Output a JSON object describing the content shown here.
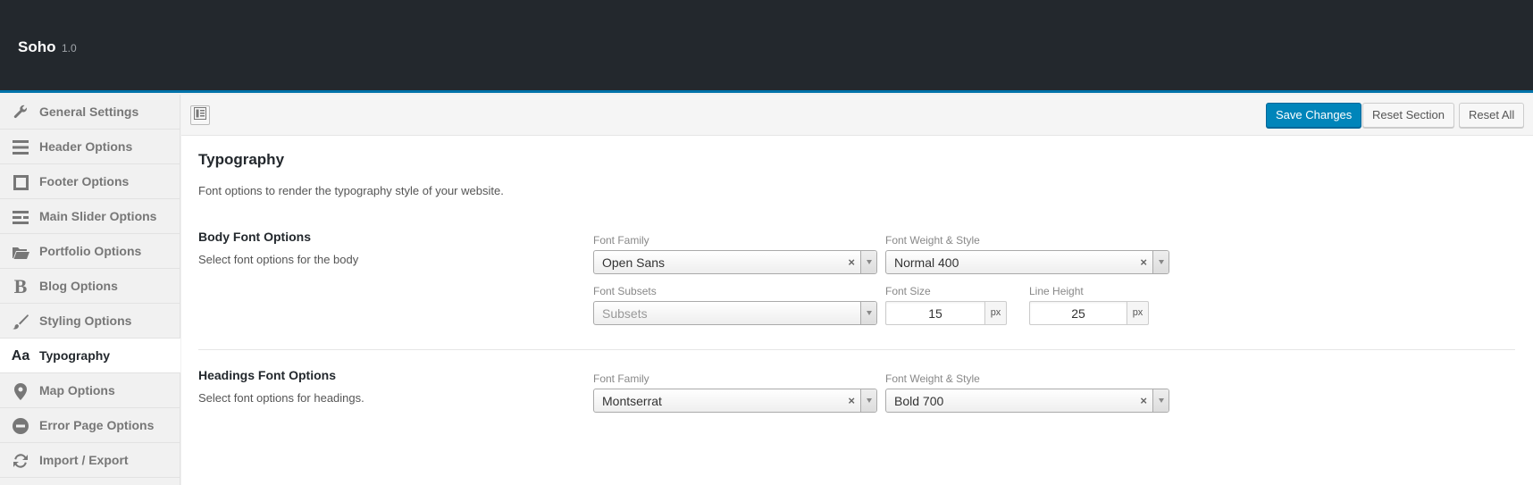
{
  "header": {
    "brand": "Soho",
    "version": "1.0"
  },
  "sidebar": {
    "items": [
      {
        "label": "General Settings",
        "icon": "wrench-icon"
      },
      {
        "label": "Header Options",
        "icon": "bars-icon"
      },
      {
        "label": "Footer Options",
        "icon": "square-icon"
      },
      {
        "label": "Main Slider Options",
        "icon": "slider-icon"
      },
      {
        "label": "Portfolio Options",
        "icon": "folder-open-icon"
      },
      {
        "label": "Blog Options",
        "icon": "bold-b-icon"
      },
      {
        "label": "Styling Options",
        "icon": "brush-icon"
      },
      {
        "label": "Typography",
        "icon": "font-aa-icon",
        "active": true
      },
      {
        "label": "Map Options",
        "icon": "map-marker-icon"
      },
      {
        "label": "Error Page Options",
        "icon": "minus-circle-icon"
      },
      {
        "label": "Import / Export",
        "icon": "refresh-icon"
      }
    ]
  },
  "toolbar": {
    "save_label": "Save Changes",
    "reset_section_label": "Reset Section",
    "reset_all_label": "Reset All"
  },
  "section": {
    "title": "Typography",
    "description": "Font options to render the typography style of your website."
  },
  "body_font": {
    "title": "Body Font Options",
    "description": "Select font options for the body",
    "font_family_label": "Font Family",
    "font_family_value": "Open Sans",
    "font_weight_label": "Font Weight & Style",
    "font_weight_value": "Normal 400",
    "font_subsets_label": "Font Subsets",
    "font_subsets_placeholder": "Subsets",
    "font_size_label": "Font Size",
    "font_size_value": "15",
    "line_height_label": "Line Height",
    "line_height_value": "25",
    "unit": "px"
  },
  "headings_font": {
    "title": "Headings Font Options",
    "description": "Select font options for headings.",
    "font_family_label": "Font Family",
    "font_family_value": "Montserrat",
    "font_weight_label": "Font Weight & Style",
    "font_weight_value": "Bold 700"
  },
  "colors": {
    "accent": "#0085ba",
    "topbar": "#23282d",
    "topbar_border": "#0073aa"
  }
}
